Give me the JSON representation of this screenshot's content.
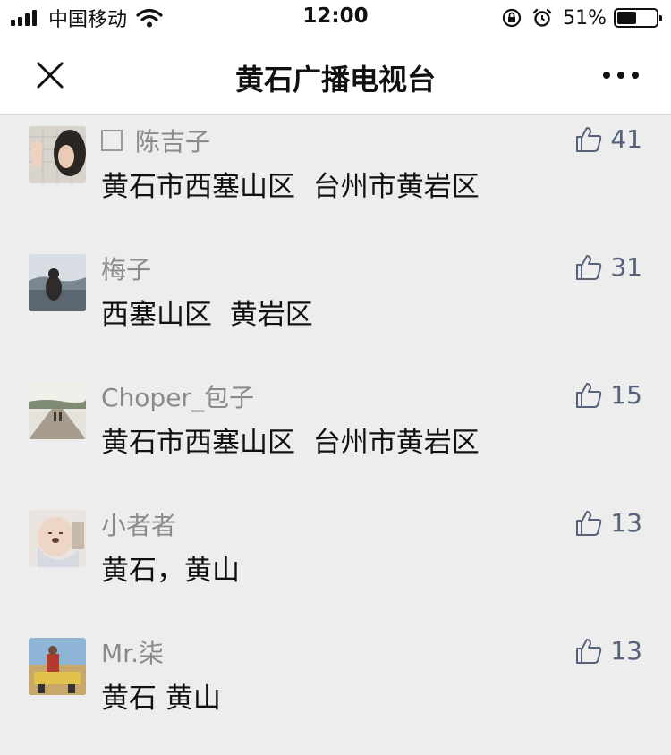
{
  "status_bar": {
    "carrier": "中国移动",
    "time": "12:00",
    "battery_percent": "51%",
    "battery_level": 0.51
  },
  "nav": {
    "title": "黄石广播电视台",
    "close_icon": "close-icon",
    "more_icon": "more-icon"
  },
  "comments": [
    {
      "nickname": "陈吉子",
      "content": "黄石市西塞山区  台州市黄岩区",
      "likes": "41"
    },
    {
      "nickname": "梅子",
      "content": "西塞山区  黄岩区",
      "likes": "31"
    },
    {
      "nickname": "Choper_包子",
      "content": "黄石市西塞山区  台州市黄岩区",
      "likes": "15"
    },
    {
      "nickname": "小者者",
      "content": "黄石，黄山",
      "likes": "13"
    },
    {
      "nickname": "Mr.柒",
      "content": "黄石 黄山",
      "likes": "13"
    }
  ],
  "colors": {
    "background": "#ededed",
    "nickname": "#8a8a8a",
    "like": "#56627a",
    "text": "#111111"
  }
}
